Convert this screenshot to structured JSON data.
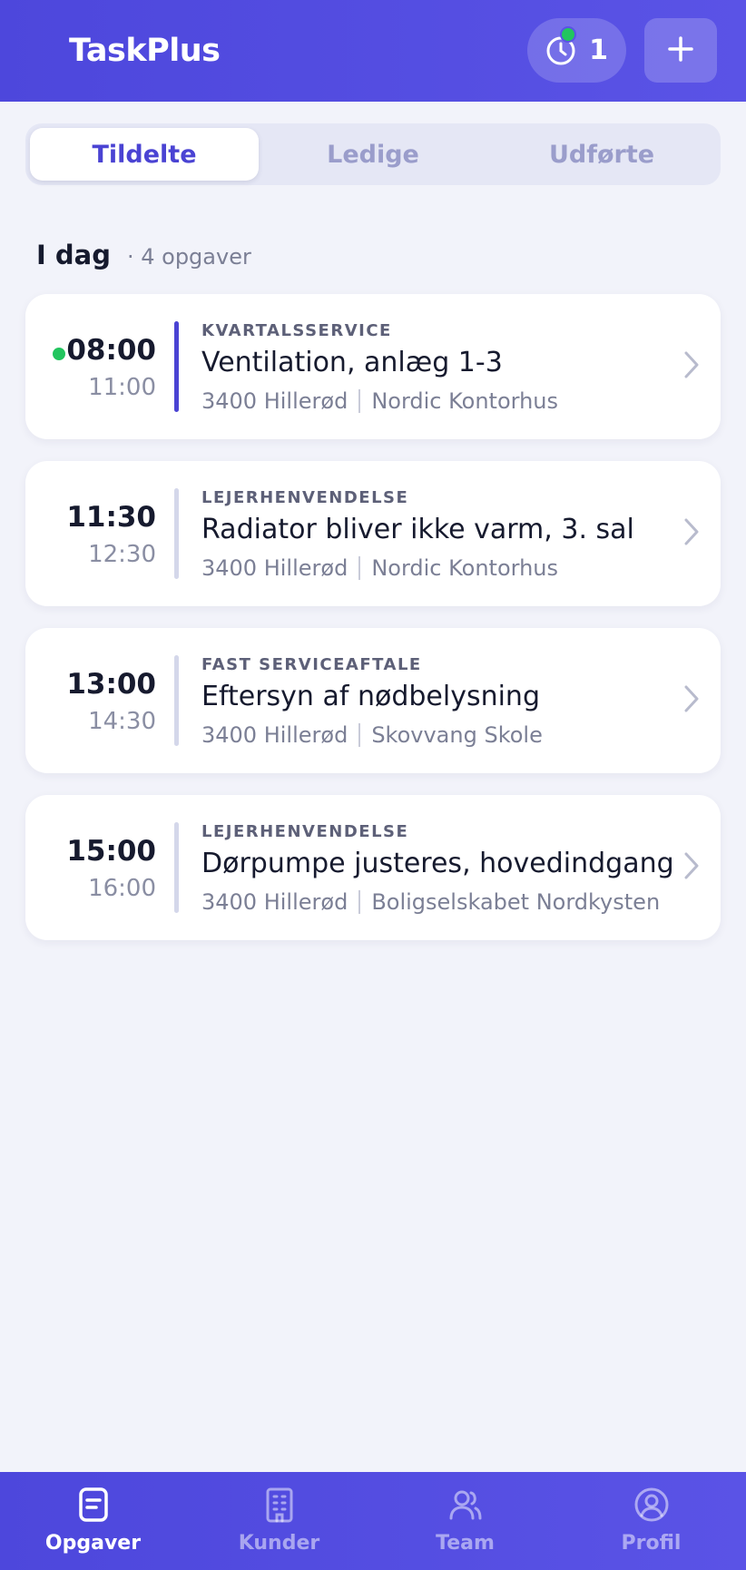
{
  "header": {
    "title": "TaskPlus",
    "timer_count": "1",
    "timer_icon": "clock-icon",
    "add_icon": "plus-icon"
  },
  "tabs": [
    {
      "label": "Tildelte",
      "active": true
    },
    {
      "label": "Ledige",
      "active": false
    },
    {
      "label": "Udførte",
      "active": false
    }
  ],
  "section": {
    "title": "I dag",
    "count": "· 4 opgaver"
  },
  "tasks": [
    {
      "start": "08:00",
      "end": "11:00",
      "category": "KVARTALSSERVICE",
      "title": "Ventilation, anlæg 1-3",
      "location": "3400 Hillerød",
      "customer": "Nordic Kontorhus",
      "active": true
    },
    {
      "start": "11:30",
      "end": "12:30",
      "category": "LEJERHENVENDELSE",
      "title": "Radiator bliver ikke varm, 3. sal",
      "location": "3400 Hillerød",
      "customer": "Nordic Kontorhus",
      "active": false
    },
    {
      "start": "13:00",
      "end": "14:30",
      "category": "FAST SERVICEAFTALE",
      "title": "Eftersyn af nødbelysning",
      "location": "3400 Hillerød",
      "customer": "Skovvang Skole",
      "active": false
    },
    {
      "start": "15:00",
      "end": "16:00",
      "category": "LEJERHENVENDELSE",
      "title": "Dørpumpe justeres, hovedindgang",
      "location": "3400 Hillerød",
      "customer": "Boligselskabet Nordkysten",
      "active": false
    }
  ],
  "nav": [
    {
      "label": "Opgaver",
      "icon": "clipboard-icon",
      "active": true
    },
    {
      "label": "Kunder",
      "icon": "building-icon",
      "active": false
    },
    {
      "label": "Team",
      "icon": "users-icon",
      "active": false
    },
    {
      "label": "Profil",
      "icon": "user-circle-icon",
      "active": false
    }
  ],
  "colors": {
    "brand": "#4d47dc",
    "accent": "#4a43d3",
    "status_active": "#22c55e",
    "background": "#f2f3fa"
  }
}
